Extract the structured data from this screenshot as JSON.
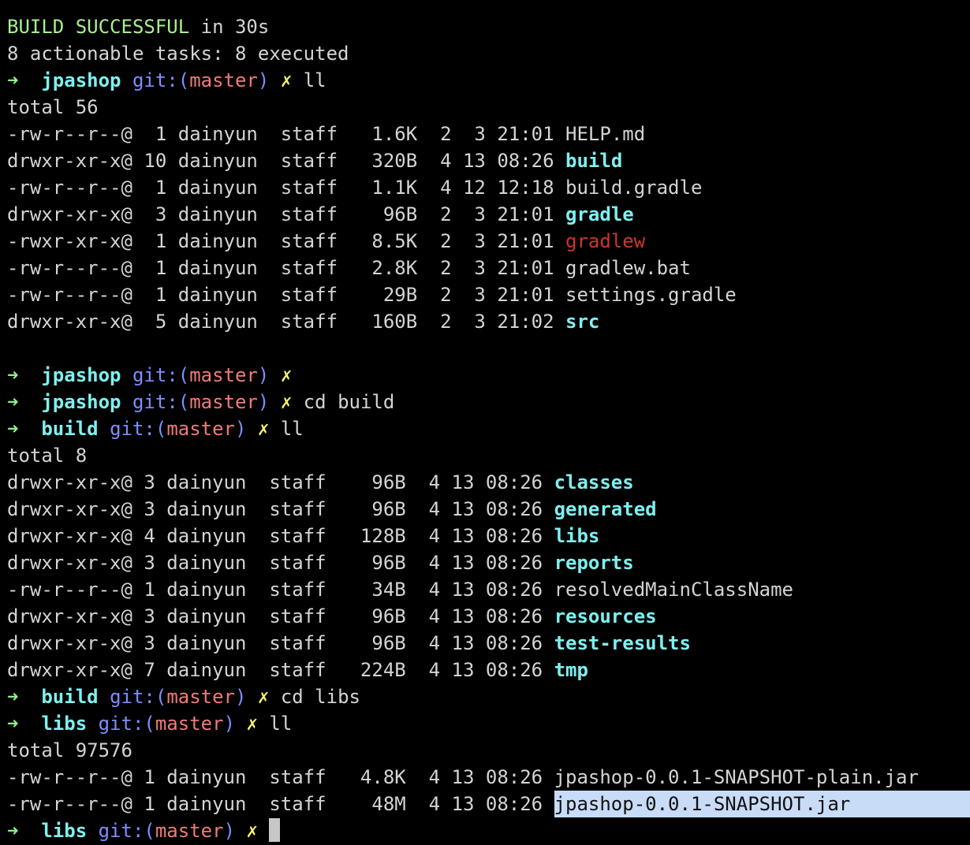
{
  "terminal": {
    "build_status": "BUILD SUCCESSFUL",
    "build_time": " in 30s",
    "tasks_line": "8 actionable tasks: 8 executed",
    "prompt_arrow": "➜",
    "git_prefix": "git:(",
    "git_suffix": ")",
    "branch": "master",
    "dirty_mark": "✗",
    "prompts": [
      {
        "dir": "jpashop",
        "command": "ll"
      },
      {
        "dir": "jpashop",
        "command": ""
      },
      {
        "dir": "jpashop",
        "command": "cd build"
      },
      {
        "dir": "build",
        "command": "ll"
      },
      {
        "dir": "build",
        "command": "cd libs"
      },
      {
        "dir": "libs",
        "command": "ll"
      },
      {
        "dir": "libs",
        "command": ""
      }
    ],
    "listing1": {
      "total": "total 56",
      "rows": [
        {
          "meta": "-rw-r--r--@  1 dainyun  staff   1.6K  2  3 21:01 ",
          "name": "HELP.md",
          "kind": "file"
        },
        {
          "meta": "drwxr-xr-x@ 10 dainyun  staff   320B  4 13 08:26 ",
          "name": "build",
          "kind": "dir"
        },
        {
          "meta": "-rw-r--r--@  1 dainyun  staff   1.1K  4 12 12:18 ",
          "name": "build.gradle",
          "kind": "file"
        },
        {
          "meta": "drwxr-xr-x@  3 dainyun  staff    96B  2  3 21:01 ",
          "name": "gradle",
          "kind": "dir"
        },
        {
          "meta": "-rwxr-xr-x@  1 dainyun  staff   8.5K  2  3 21:01 ",
          "name": "gradlew",
          "kind": "exec"
        },
        {
          "meta": "-rw-r--r--@  1 dainyun  staff   2.8K  2  3 21:01 ",
          "name": "gradlew.bat",
          "kind": "file"
        },
        {
          "meta": "-rw-r--r--@  1 dainyun  staff    29B  2  3 21:01 ",
          "name": "settings.gradle",
          "kind": "file"
        },
        {
          "meta": "drwxr-xr-x@  5 dainyun  staff   160B  2  3 21:02 ",
          "name": "src",
          "kind": "dir"
        }
      ]
    },
    "listing2": {
      "total": "total 8",
      "rows": [
        {
          "meta": "drwxr-xr-x@ 3 dainyun  staff    96B  4 13 08:26 ",
          "name": "classes",
          "kind": "dir"
        },
        {
          "meta": "drwxr-xr-x@ 3 dainyun  staff    96B  4 13 08:26 ",
          "name": "generated",
          "kind": "dir"
        },
        {
          "meta": "drwxr-xr-x@ 4 dainyun  staff   128B  4 13 08:26 ",
          "name": "libs",
          "kind": "dir"
        },
        {
          "meta": "drwxr-xr-x@ 3 dainyun  staff    96B  4 13 08:26 ",
          "name": "reports",
          "kind": "dir"
        },
        {
          "meta": "-rw-r--r--@ 1 dainyun  staff    34B  4 13 08:26 ",
          "name": "resolvedMainClassName",
          "kind": "file"
        },
        {
          "meta": "drwxr-xr-x@ 3 dainyun  staff    96B  4 13 08:26 ",
          "name": "resources",
          "kind": "dir"
        },
        {
          "meta": "drwxr-xr-x@ 3 dainyun  staff    96B  4 13 08:26 ",
          "name": "test-results",
          "kind": "dir"
        },
        {
          "meta": "drwxr-xr-x@ 7 dainyun  staff   224B  4 13 08:26 ",
          "name": "tmp",
          "kind": "dir"
        }
      ]
    },
    "listing3": {
      "total": "total 97576",
      "rows": [
        {
          "meta": "-rw-r--r--@ 1 dainyun  staff   4.8K  4 13 08:26 ",
          "name": "jpashop-0.0.1-SNAPSHOT-plain.jar",
          "kind": "file"
        },
        {
          "meta": "-rw-r--r--@ 1 dainyun  staff    48M  4 13 08:26 ",
          "name": "jpashop-0.0.1-SNAPSHOT.jar",
          "kind": "file",
          "selected": true
        }
      ]
    }
  },
  "colors": {
    "background": "#000000",
    "text": "#d4d4d4",
    "arrow": "#8ff08a",
    "directory": "#7ef0ef",
    "git": "#7f8cff",
    "branch": "#f07a78",
    "dirty": "#f5f56a",
    "executable": "#d0342c",
    "selection": "#c8dcf8"
  }
}
